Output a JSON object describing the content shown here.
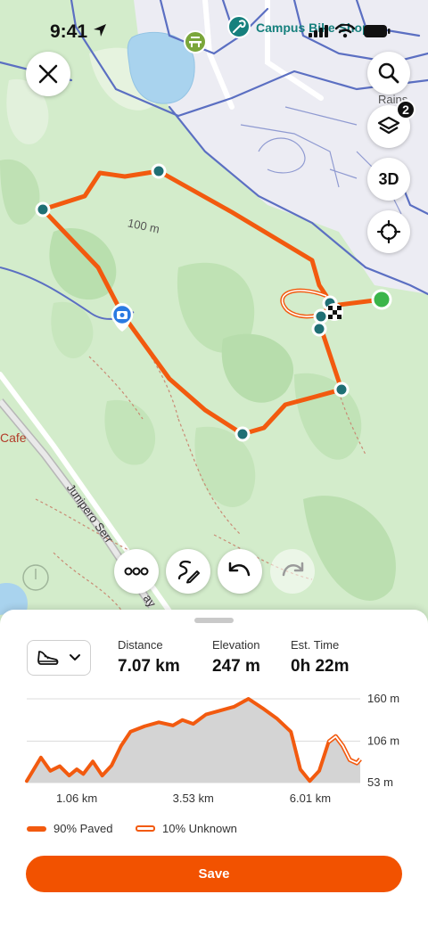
{
  "status_bar": {
    "time": "9:41"
  },
  "map": {
    "poi_label": "Campus Bike Shop",
    "area_label": "Rains Hou",
    "contour_label": "100 m",
    "cafe_label": "Cafe",
    "road_label": "Junipero Serra Blvd... ay",
    "road_label_start": "Junipero Serr",
    "road_label_end": "ay"
  },
  "map_controls": {
    "close_icon": "close-icon",
    "search_icon": "search-icon",
    "layers_icon": "layers-icon",
    "layers_badge": "2",
    "three_d_label": "3D",
    "locate_icon": "crosshair-icon"
  },
  "tools": {
    "more_icon": "more-icon",
    "draw_route_icon": "draw-route-icon",
    "undo_icon": "undo-icon",
    "redo_icon": "redo-icon"
  },
  "colors": {
    "route": "#f25a0f",
    "waypoint": "#1f6f74",
    "start": "#3bb54a",
    "map_green": "#cfe9c6",
    "save_button": "#f25200"
  },
  "route_stats": {
    "sport_icon": "running-shoe-icon",
    "distance_label": "Distance",
    "distance_value": "7.07 km",
    "elevation_label": "Elevation",
    "elevation_value": "247 m",
    "time_label": "Est. Time",
    "time_value": "0h 22m"
  },
  "chart_data": {
    "type": "area",
    "xlabel": "",
    "ylabel": "",
    "x_ticks": [
      "1.06 km",
      "3.53 km",
      "6.01 km"
    ],
    "y_ticks": [
      "160 m",
      "106 m",
      "53 m"
    ],
    "ylim": [
      53,
      160
    ],
    "xlim": [
      0,
      7.07
    ],
    "grid": true,
    "series": [
      {
        "name": "90% Paved",
        "style": "solid",
        "x": [
          0,
          0.3,
          0.5,
          0.7,
          0.9,
          1.06,
          1.2,
          1.4,
          1.6,
          1.8,
          2.0,
          2.2,
          2.5,
          2.8,
          3.1,
          3.3,
          3.53,
          3.8,
          4.1,
          4.4,
          4.7,
          5.0,
          5.3,
          5.6,
          5.8,
          6.0,
          6.2,
          6.4
        ],
        "y": [
          55,
          85,
          68,
          74,
          62,
          70,
          64,
          80,
          62,
          75,
          100,
          118,
          125,
          130,
          126,
          133,
          128,
          140,
          145,
          150,
          160,
          148,
          135,
          118,
          70,
          55,
          68,
          105
        ]
      },
      {
        "name": "10% Unknown",
        "style": "outline",
        "x": [
          6.4,
          6.55,
          6.7,
          6.85,
          7.0,
          7.07
        ],
        "y": [
          105,
          112,
          100,
          82,
          78,
          83
        ]
      }
    ],
    "legend": "bottom-left"
  },
  "legend": {
    "paved_label": "90% Paved",
    "unknown_label": "10% Unknown"
  },
  "actions": {
    "save_label": "Save"
  }
}
